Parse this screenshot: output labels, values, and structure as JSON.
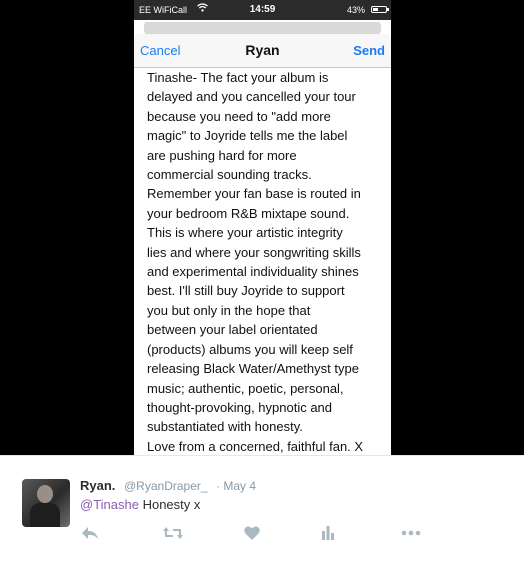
{
  "status_bar": {
    "carrier": "EE WiFiCall",
    "time": "14:59",
    "battery_percent": "43%",
    "battery_level": 0.43
  },
  "compose": {
    "cancel_label": "Cancel",
    "title": "Ryan",
    "send_label": "Send",
    "message": "Tinashe- The fact your album is\ndelayed and you cancelled your tour\nbecause you need to \"add more\nmagic\" to Joyride tells me the label\nare pushing hard for more\ncommercial sounding tracks.\nRemember your fan base is routed in\nyour bedroom R&B mixtape sound.\nThis is where your artistic integrity\nlies and where your songwriting skills\nand experimental individuality shines\nbest. I'll still buy Joyride to support\nyou but only in the hope that\nbetween your label orientated\n(products) albums you will keep self\nreleasing Black Water/Amethyst type\nmusic; authentic, poetic, personal,\nthought-provoking, hypnotic and\nsubstantiated with honesty.\nLove from a concerned, faithful fan. X"
  },
  "tweet": {
    "name": "Ryan.",
    "handle": "@RyanDraper_",
    "date": "· May 4",
    "mention": "@Tinashe",
    "text": " Honesty x",
    "accent_color": "#8a5fb0"
  },
  "actions": {
    "icons": [
      "reply-icon",
      "retweet-icon",
      "like-icon",
      "analytics-icon",
      "more-icon"
    ]
  }
}
